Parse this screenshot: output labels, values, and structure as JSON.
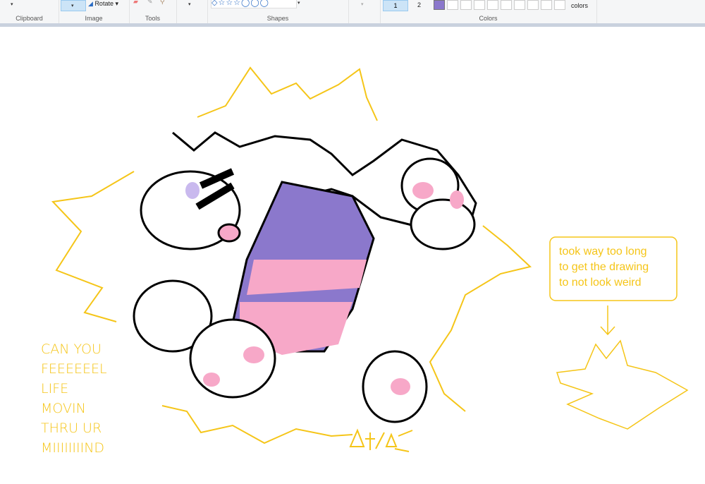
{
  "ribbon": {
    "groups": {
      "clipboard": "Clipboard",
      "image": "Image",
      "tools": "Tools",
      "shapes": "Shapes",
      "colors": "Colors"
    },
    "rotate_label": "Rotate",
    "color1_label": "1",
    "color2_label": "2",
    "edit_colors_label": "colors",
    "color1": "#8b78cc"
  },
  "drawing": {
    "left_text": [
      "CAN YOU",
      "FEEEEEEL",
      "LIFE",
      "MOVIN",
      "THRU UR",
      "MIIIIIIIIND"
    ],
    "note_lines": [
      "took way too long",
      "to get the drawing",
      "to not look weird"
    ],
    "signature": "Δt/Δ",
    "colors": {
      "outline": "#000000",
      "yellow": "#f5c518",
      "purple": "#8b78cc",
      "pink": "#f7a8c8"
    }
  }
}
